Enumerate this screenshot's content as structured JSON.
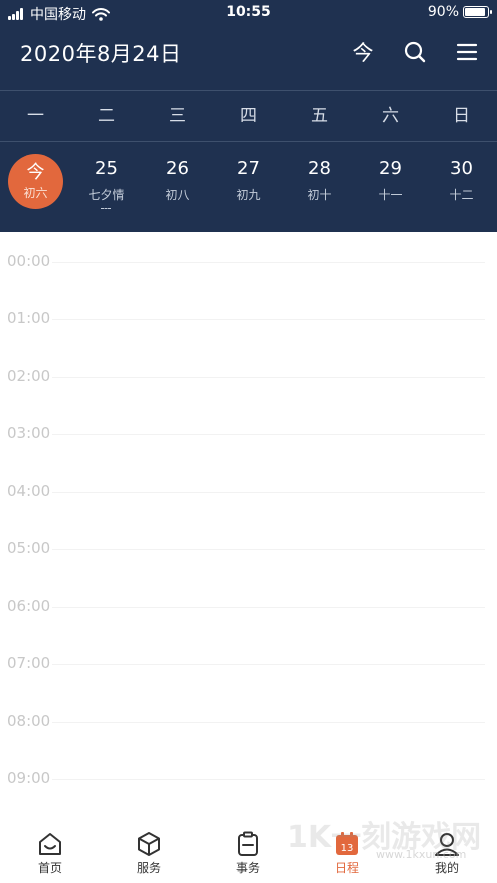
{
  "status_bar": {
    "carrier": "中国移动",
    "time": "10:55",
    "battery": "90%",
    "battery_level": 0.9,
    "signal_icon": "signal-bars-icon",
    "wifi_icon": "wifi-icon"
  },
  "header": {
    "title": "2020年8月24日",
    "today_label": "今",
    "search_icon": "search-icon",
    "menu_icon": "menu-icon",
    "background_color": "#1f3150"
  },
  "weekdays": [
    "一",
    "二",
    "三",
    "四",
    "五",
    "六",
    "日"
  ],
  "dates": [
    {
      "day": "今",
      "lunar": "初六",
      "today": true
    },
    {
      "day": "25",
      "lunar": "七夕情",
      "festival": true
    },
    {
      "day": "26",
      "lunar": "初八"
    },
    {
      "day": "27",
      "lunar": "初九"
    },
    {
      "day": "28",
      "lunar": "初十"
    },
    {
      "day": "29",
      "lunar": "十一"
    },
    {
      "day": "30",
      "lunar": "十二"
    }
  ],
  "hours": [
    "00:00",
    "01:00",
    "02:00",
    "03:00",
    "04:00",
    "05:00",
    "06:00",
    "07:00",
    "08:00",
    "09:00"
  ],
  "tabs": [
    {
      "label": "首页",
      "icon": "home-icon",
      "active": false
    },
    {
      "label": "服务",
      "icon": "cube-icon",
      "active": false
    },
    {
      "label": "事务",
      "icon": "clipboard-icon",
      "active": false
    },
    {
      "label": "日程",
      "icon": "calendar-icon",
      "active": true
    },
    {
      "label": "我的",
      "icon": "user-icon",
      "active": false
    }
  ],
  "accent_color": "#e2683d",
  "watermark": {
    "main": "1K一刻游戏网",
    "small": "www.1kxun.com"
  }
}
